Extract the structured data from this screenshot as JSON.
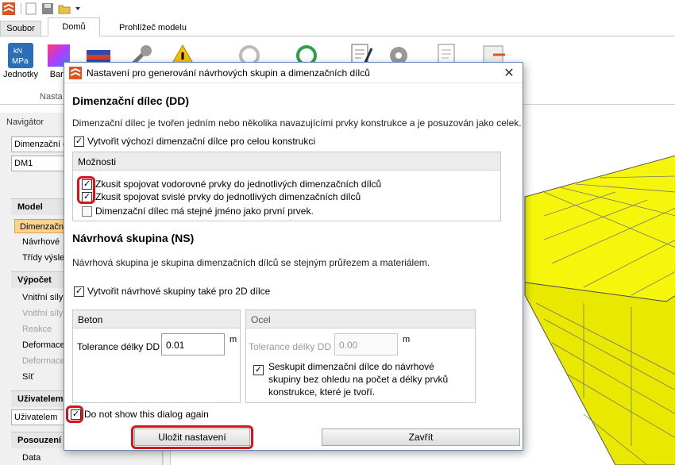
{
  "quick_access": {
    "icons": [
      "app-logo-icon",
      "new-file-icon",
      "save-icon",
      "open-folder-icon",
      "dropdown-arrow-icon"
    ]
  },
  "tabs": [
    {
      "label": "Soubor"
    },
    {
      "label": "Domů"
    },
    {
      "label": "Prohlížeč modelu"
    }
  ],
  "ribbon": {
    "buttons": [
      {
        "label": "Jednotky",
        "icon": "units-icon"
      },
      {
        "label": "Barv",
        "icon": "colors-icon"
      }
    ],
    "group_label": "Nasta"
  },
  "navigator": {
    "title": "Navigátor",
    "dropdown_value": "Dimenzační d",
    "dm_value": "DM1",
    "sections": {
      "model": {
        "title": "Model",
        "items": [
          "Dimenzační",
          "Návrhové",
          "Třídy výsle"
        ]
      },
      "vypocet": {
        "title": "Výpočet",
        "items": [
          "Vnitřní síly",
          "Vnitřní síly",
          "Reakce",
          "Deformace",
          "Deformace",
          "Síť"
        ]
      },
      "uzivatelem": {
        "title": "Uživatelem",
        "items": [
          "Uživatelem"
        ]
      },
      "posouzeni": {
        "title": "Posouzení",
        "items": [
          "Data"
        ]
      }
    }
  },
  "dialog": {
    "title": "Nastavení pro generování návrhových skupin a dimenzačních dílců",
    "dd": {
      "heading": "Dimenzační dílec (DD)",
      "description": "Dimenzační dílec je tvořen jedním nebo několika navazujícími prvky konstrukce a je posuzován jako celek.",
      "create_default_label": "Vytvořit výchozí dimenzační dílce pro celou konstrukci",
      "create_default_checked": true,
      "options_title": "Možnosti",
      "options": [
        {
          "label": "Zkusit spojovat vodorovné prvky do jednotlivých dimenzačních dílců",
          "checked": true
        },
        {
          "label": "Zkusit spojovat svislé prvky do jednotlivých dimenzačních dílců",
          "checked": true
        },
        {
          "label": "Dimenzační dílec má stejné jméno jako první prvek.",
          "checked": false
        }
      ]
    },
    "ns": {
      "heading": "Návrhová skupina (NS)",
      "description": "Návrhová skupina je skupina dimenzačních dílců se stejným průřezem a materiálem.",
      "create_2d_label": "Vytvořit návrhové skupiny také pro 2D dílce",
      "create_2d_checked": true,
      "beton": {
        "title": "Beton",
        "tolerance_label": "Tolerance délky DD",
        "tolerance_value": "0.01",
        "unit": "m"
      },
      "ocel": {
        "title": "Ocel",
        "tolerance_label": "Tolerance délky DD",
        "tolerance_placeholder": "0.00",
        "unit": "m",
        "group_label": "Seskupit dimenzační dílce do návrhové skupiny bez ohledu na počet a délky prvků konstrukce, které je tvoří.",
        "group_checked": true
      }
    },
    "dont_show_label": "Do not show this dialog again",
    "dont_show_checked": true,
    "save_button": "Uložit nastavení",
    "close_button": "Zavřít"
  },
  "colors": {
    "accent": "#e0521e",
    "highlight": "#d7141e",
    "model_fill": "#f6f60c",
    "active_nav": "#fdd48e"
  }
}
